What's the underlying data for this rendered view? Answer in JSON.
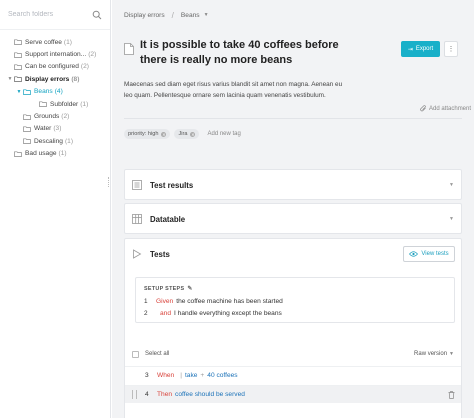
{
  "sidebar": {
    "search_placeholder": "Search folders",
    "items": [
      {
        "label": "Serve coffee",
        "count": "(1)"
      },
      {
        "label": "Support internation...",
        "count": "(2)"
      },
      {
        "label": "Can be configured",
        "count": "(2)"
      },
      {
        "label": "Display errors",
        "count": "(8)"
      },
      {
        "label": "Beans",
        "count": "(4)"
      },
      {
        "label": "Subfolder",
        "count": "(1)"
      },
      {
        "label": "Grounds",
        "count": "(2)"
      },
      {
        "label": "Water",
        "count": "(3)"
      },
      {
        "label": "Descaling",
        "count": "(1)"
      },
      {
        "label": "Bad usage",
        "count": "(1)"
      }
    ]
  },
  "breadcrumb": {
    "root": "Display errors",
    "separator": "/",
    "current": "Beans"
  },
  "test": {
    "title": "It is possible to take 40 coffees before there is really no more beans",
    "description": "Maecenas sed diam eget risus varius blandit sit amet non magna. Aenean eu leo quam. Pellentesque ornare sem lacinia quam venenatis vestibulum.",
    "export_label": "Export",
    "more_label": "⋮",
    "add_attachment": "Add attachment",
    "tags": [
      {
        "label": "priority: high"
      },
      {
        "label": "Jira"
      }
    ],
    "add_tag": "Add new tag"
  },
  "panels": {
    "results": "Test results",
    "datatable": "Datatable",
    "tests": "Tests",
    "view_tests": "View tests"
  },
  "setup": {
    "label": "SETUP STEPS",
    "steps": [
      {
        "num": "1",
        "keyword": "Given",
        "text": "the coffee machine has been started"
      },
      {
        "num": "2",
        "keyword": "and",
        "text": "I handle everything except the beans"
      }
    ]
  },
  "scenario": {
    "select_all": "Select all",
    "raw_version": "Raw version",
    "lines": [
      {
        "num": "3",
        "keyword": "When",
        "text": "take",
        "param": "40 coffees"
      },
      {
        "num": "4",
        "keyword": "Then",
        "text": "coffee should be served"
      }
    ]
  },
  "colors": {
    "accent": "#19b0c9",
    "keyword": "#d8423a",
    "link": "#1b72b8"
  }
}
